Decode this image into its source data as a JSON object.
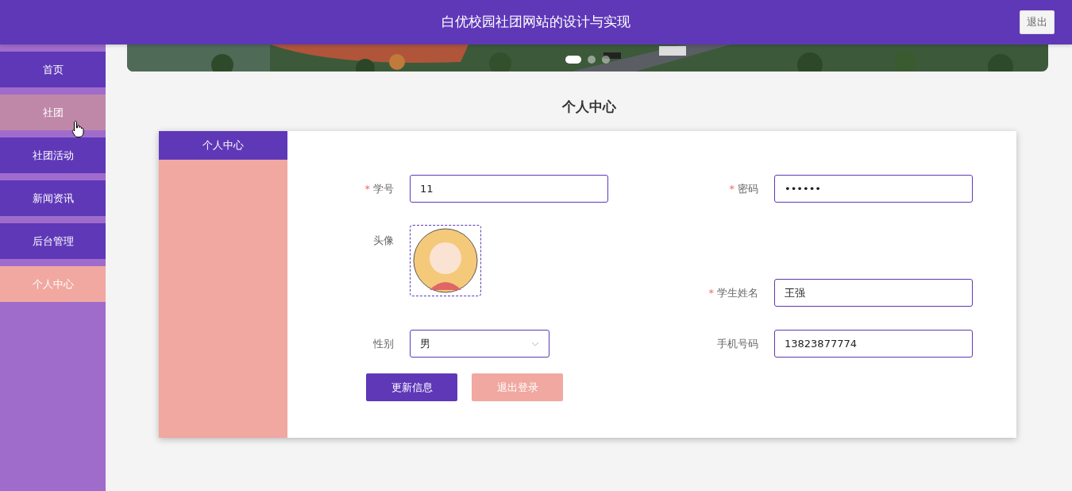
{
  "header": {
    "title": "白优校园社团网站的设计与实现",
    "logout_button": "退出"
  },
  "sidebar": {
    "items": [
      {
        "label": "首页",
        "selected": false,
        "hovered": false
      },
      {
        "label": "社团",
        "selected": false,
        "hovered": true
      },
      {
        "label": "社团活动",
        "selected": false,
        "hovered": false
      },
      {
        "label": "新闻资讯",
        "selected": false,
        "hovered": false
      },
      {
        "label": "后台管理",
        "selected": false,
        "hovered": false
      },
      {
        "label": "个人中心",
        "selected": true,
        "hovered": false
      }
    ]
  },
  "banner": {
    "kind": "picture",
    "slides": [
      {
        "selected": true
      },
      {
        "selected": false
      },
      {
        "selected": false
      }
    ]
  },
  "page_title": "个人中心",
  "side_panel": {
    "title": "个人中心"
  },
  "form": {
    "fields": [
      {
        "kind": "text",
        "label": "学号",
        "required_mark": "*",
        "value": "11"
      },
      {
        "kind": "text",
        "label": "密码",
        "required_mark": "*",
        "value": "••••••"
      },
      {
        "kind": "avatar",
        "label": "头像"
      },
      {
        "kind": "text",
        "label": "学生姓名",
        "required_mark": "*",
        "value": "王强"
      },
      {
        "kind": "select",
        "label": "性别",
        "value": "男"
      },
      {
        "kind": "text",
        "label": "手机号码",
        "value": "13823877774"
      }
    ],
    "buttons": [
      {
        "label": "更新信息",
        "kind": "primary"
      },
      {
        "label": "退出登录",
        "kind": "secondary"
      }
    ]
  }
}
